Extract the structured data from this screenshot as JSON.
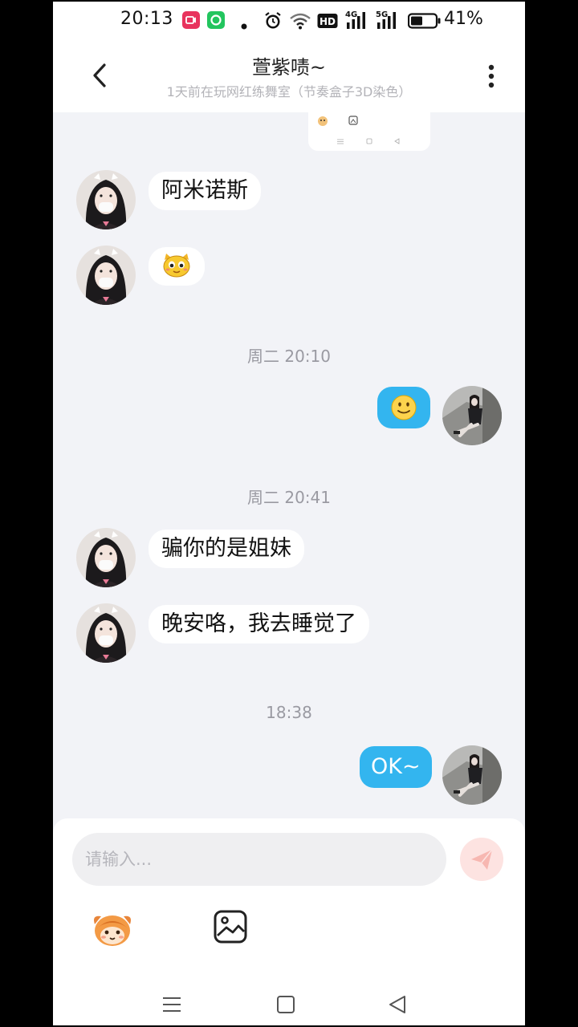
{
  "status_bar": {
    "time": "20:13",
    "network_4g": "4G",
    "network_5g": "5G",
    "hd_badge": "HD",
    "battery_percent": "41%",
    "battery_level": 0.41
  },
  "header": {
    "title": "萱紫啧~",
    "subtitle": "1天前在玩网红练舞室（节奏盒子3D染色）"
  },
  "messages": [
    {
      "type": "text",
      "direction": "incoming",
      "text": "阿米诺斯"
    },
    {
      "type": "sticker",
      "direction": "incoming",
      "sticker": "yellow-cat-face"
    },
    {
      "type": "timestamp",
      "text": "周二 20:10"
    },
    {
      "type": "emoji",
      "direction": "outgoing",
      "text": "🙂"
    },
    {
      "type": "timestamp",
      "text": "周二 20:41"
    },
    {
      "type": "text",
      "direction": "incoming",
      "text": "骗你的是姐妹"
    },
    {
      "type": "text",
      "direction": "incoming",
      "text": "晚安咯，我去睡觉了"
    },
    {
      "type": "timestamp",
      "text": "18:38"
    },
    {
      "type": "text",
      "direction": "outgoing",
      "text": "OK~"
    }
  ],
  "input": {
    "placeholder": "请输入..."
  },
  "colors": {
    "outgoing_bubble": "#33b5ef",
    "background": "#f2f3f7",
    "send_button": "#fde3e1",
    "send_icon": "#f7b7b1"
  },
  "icons": [
    "back-arrow-icon",
    "more-vertical-icon",
    "send-icon",
    "emoji-mascot-icon",
    "image-picker-icon",
    "menu-nav-icon",
    "home-nav-icon",
    "back-nav-icon"
  ]
}
